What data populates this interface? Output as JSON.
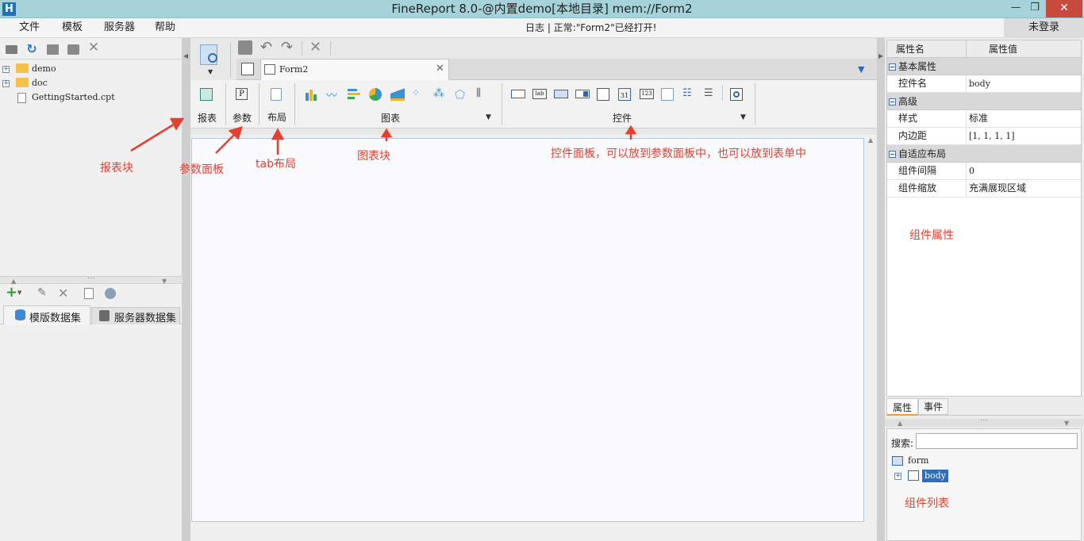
{
  "window": {
    "title": "FineReport 8.0-@内置demo[本地目录]     mem://Form2",
    "logo": "H",
    "minimize": "—",
    "restore": "❐",
    "close": "✕"
  },
  "menu": {
    "items": [
      "文件",
      "模板",
      "服务器",
      "帮助"
    ],
    "status": "日志 | 正常:\"Form2\"已经打开!",
    "login": "未登录"
  },
  "file_tree": {
    "items": [
      {
        "label": "demo",
        "type": "folder"
      },
      {
        "label": "doc",
        "type": "folder"
      },
      {
        "label": "GettingStarted.cpt",
        "type": "file"
      }
    ]
  },
  "dataset_tabs": {
    "template": "模版数据集",
    "server": "服务器数据集"
  },
  "editor": {
    "tab_title": "Form2"
  },
  "widget_toolbar": {
    "report": "报表",
    "param": "参数",
    "layout": "布局",
    "chart": "图表",
    "control": "控件"
  },
  "annotations": {
    "report_block": "报表块",
    "param_panel": "参数面板",
    "tab_layout": "tab布局",
    "chart_block": "图表块",
    "control_panel": "控件面板，可以放到参数面板中，也可以放到表单中",
    "widget_props": "组件属性",
    "widget_list": "组件列表"
  },
  "properties": {
    "header_name": "属性名",
    "header_value": "属性值",
    "cat_basic": "基本属性",
    "row_name_label": "控件名",
    "row_name_value": "body",
    "cat_advanced": "高级",
    "row_style_label": "样式",
    "row_style_value": "标准",
    "row_padding_label": "内边距",
    "row_padding_value": "[1, 1, 1, 1]",
    "cat_adaptive": "自适应布局",
    "row_gap_label": "组件间隔",
    "row_gap_value": "0",
    "row_scale_label": "组件缩放",
    "row_scale_value": "充满展现区域",
    "tab_props": "属性",
    "tab_events": "事件"
  },
  "widget_tree": {
    "search_label": "搜索:",
    "root": "form",
    "child": "body"
  }
}
